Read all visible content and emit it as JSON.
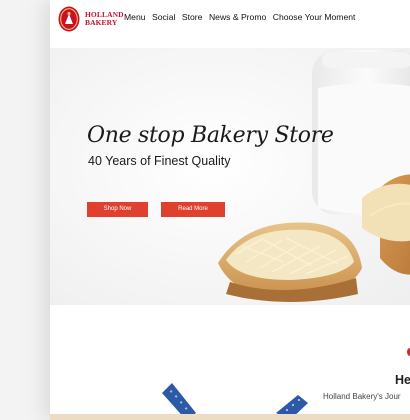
{
  "brand": {
    "logo_line1": "HOLLAND",
    "logo_line2": "BAKERY"
  },
  "nav": {
    "items": [
      {
        "label": "Menu"
      },
      {
        "label": "Social"
      },
      {
        "label": "Store"
      },
      {
        "label": "News & Promo"
      },
      {
        "label": "Choose Your Moment"
      }
    ]
  },
  "hero": {
    "title": "One stop Bakery Store",
    "subtitle": "40 Years of Finest Quality",
    "shop_now_label": "Shop Now",
    "read_more_label": "Read More"
  },
  "section": {
    "heading_partial": "He",
    "subheading_partial": "Holland Bakery's Jour"
  },
  "colors": {
    "accent": "#e0412f",
    "brand_red": "#c8102e",
    "strip": "#ecdcc4"
  }
}
